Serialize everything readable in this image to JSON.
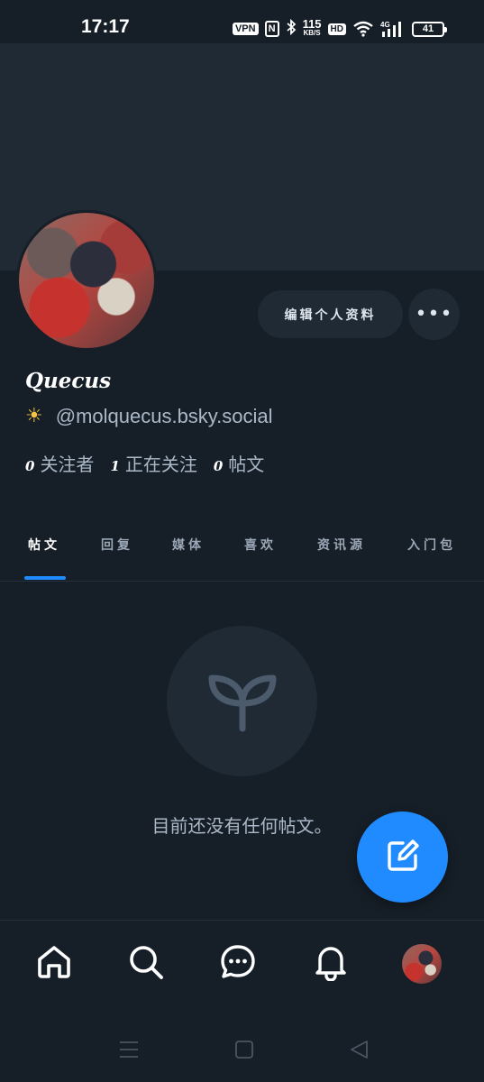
{
  "status_bar": {
    "time": "17:17",
    "vpn": "VPN",
    "nfc": "N",
    "speed_value": "115",
    "speed_unit": "KB/S",
    "hd": "HD",
    "network": "4G",
    "battery": "41"
  },
  "profile": {
    "display_name": "Quecus",
    "handle_emoji": "☀",
    "handle": "@molquecus.bsky.social",
    "edit_button_label": "编辑个人资料",
    "more_button_label": "•••",
    "stats": [
      {
        "count": "0",
        "label": "关注者"
      },
      {
        "count": "1",
        "label": "正在关注"
      },
      {
        "count": "0",
        "label": "帖文"
      }
    ]
  },
  "tabs": [
    {
      "label": "帖文",
      "active": true
    },
    {
      "label": "回复",
      "active": false
    },
    {
      "label": "媒体",
      "active": false
    },
    {
      "label": "喜欢",
      "active": false
    },
    {
      "label": "资讯源",
      "active": false
    },
    {
      "label": "入门包",
      "active": false
    }
  ],
  "empty_state": {
    "icon": "sprout-icon",
    "message": "目前还没有任何帖文。"
  },
  "fab": {
    "icon": "compose-icon"
  },
  "bottom_nav": [
    {
      "name": "home",
      "icon": "home-icon"
    },
    {
      "name": "search",
      "icon": "search-icon"
    },
    {
      "name": "messages",
      "icon": "chat-icon"
    },
    {
      "name": "notifications",
      "icon": "bell-icon"
    },
    {
      "name": "profile",
      "icon": "avatar"
    }
  ],
  "colors": {
    "background": "#161e27",
    "surface": "#1f2a35",
    "accent": "#208bfe",
    "muted_text": "#aab8c8"
  }
}
